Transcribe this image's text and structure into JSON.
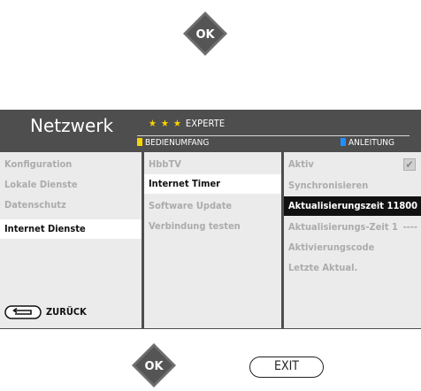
{
  "top_key": {
    "label": "OK",
    "icon": "ok-button-icon"
  },
  "bottom_keys": [
    {
      "label": "OK",
      "icon": "ok-button-icon"
    },
    {
      "label": "EXIT"
    }
  ],
  "menu": {
    "title": "Netzwerk",
    "level": {
      "stars": "★ ★ ★",
      "label": "EXPERTE"
    },
    "legend_left": "BEDIENUMFANG",
    "legend_right": "ANLEITUNG",
    "colors": {
      "yellow": "#f7d300",
      "blue": "#1e90ff",
      "panel": "#4e4e4e",
      "body": "#ebebeb"
    },
    "col1": [
      {
        "label": "Konfiguration"
      },
      {
        "label": "Lokale Dienste"
      },
      {
        "label": "Datenschutz"
      },
      {
        "label": "Internet Dienste",
        "selected": true
      }
    ],
    "col2": [
      {
        "label": "HbbTV"
      },
      {
        "label": "Internet Timer",
        "selected": true
      },
      {
        "label": "Software Update"
      },
      {
        "label": "Verbindung testen"
      }
    ],
    "col3": [
      {
        "label": "Aktiv",
        "checked": true
      },
      {
        "label": "Synchronisieren"
      },
      {
        "label": "Aktualisierungszeit 1",
        "value": "1800",
        "highlighted": true
      },
      {
        "label": "Aktualisierungs-Zeit 1",
        "value": "----"
      },
      {
        "label": "Aktivierungscode"
      },
      {
        "label": "Letzte Aktual."
      }
    ],
    "back_label": "ZURÜCK",
    "back_icon": "back-arrow-icon"
  }
}
